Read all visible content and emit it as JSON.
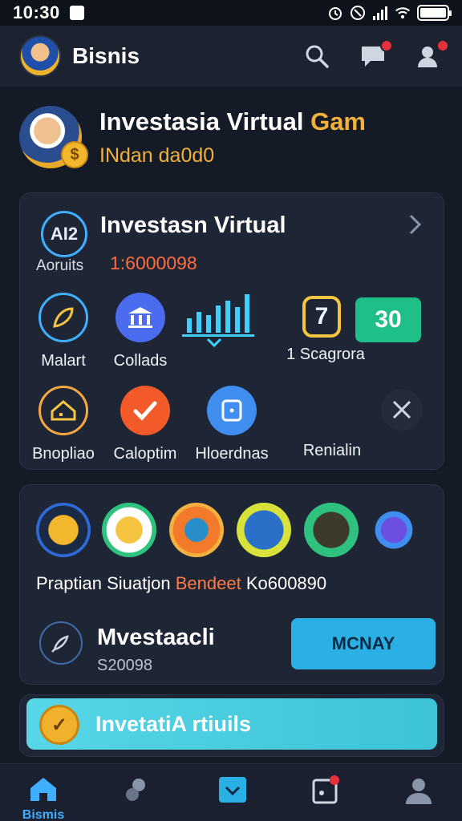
{
  "status_bar": {
    "time": "10:30"
  },
  "app_bar": {
    "title": "Bisnis"
  },
  "hero": {
    "title_main": "Investasia Virtual",
    "title_accent": "Gam",
    "subtitle": "INdan da0d0"
  },
  "card1": {
    "icon_text": "AI2",
    "title": "Investasn Virtual",
    "label": "Aoruits",
    "value": "1:6000098",
    "seven": "7",
    "badge": "30",
    "row1": [
      "Malart",
      "Collads",
      "1 Scagrora"
    ],
    "row2": [
      "Bnopliao",
      "Caloptim",
      "Hloerdnas",
      "Renialin"
    ]
  },
  "card2": {
    "texts": [
      "Praptian",
      "Siuatjon",
      "Bendeet",
      "Ko600890"
    ],
    "title": "Mvestaacli",
    "sub": "S20098",
    "button": "MCNAY"
  },
  "card3": {
    "banner": "InvetatiA rtiuils"
  },
  "bottom_nav": {
    "home_label": "Bismis"
  },
  "colors": {
    "accent": "#3fb0ff",
    "gold": "#f2b13a",
    "orange": "#ff6b40",
    "green": "#1fbf8a"
  }
}
